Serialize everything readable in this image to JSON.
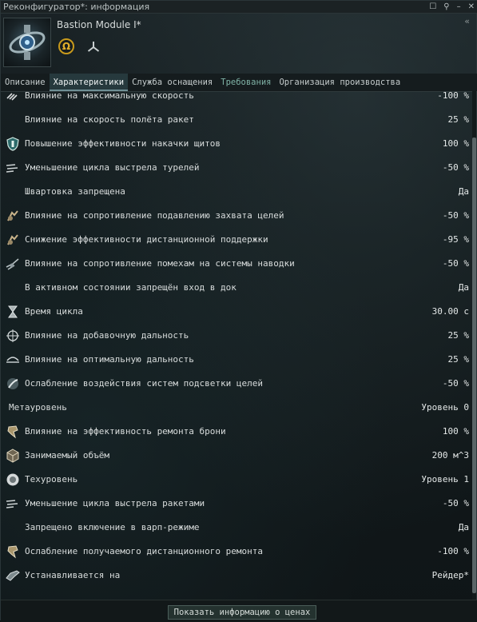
{
  "window": {
    "title": "Реконфигуратор*: информация"
  },
  "titlebar_icons": [
    "square-icon",
    "pin-icon",
    "minimize-icon",
    "close-icon"
  ],
  "item": {
    "name": "Bastion Module I*",
    "meta_badge": "Ω",
    "collapse": "«"
  },
  "tabs": [
    {
      "label": "Описание"
    },
    {
      "label": "Характеристики",
      "active": true
    },
    {
      "label": "Служба оснащения"
    },
    {
      "label": "Требования"
    },
    {
      "label": "Организация производства"
    }
  ],
  "attributes": [
    {
      "icon": "speed-icon",
      "label": "Влияние на максимальную скорость",
      "value": "-100 %"
    },
    {
      "icon": "",
      "label": "Влияние на скорость полёта ракет",
      "value": "25 %"
    },
    {
      "icon": "shield-boost-icon",
      "label": "Повышение эффективности накачки щитов",
      "value": "100 %"
    },
    {
      "icon": "turret-rof-icon",
      "label": "Уменьшение цикла выстрела турелей",
      "value": "-50 %"
    },
    {
      "icon": "",
      "label": "Швартовка запрещена",
      "value": "Да"
    },
    {
      "icon": "ewar-resist-icon",
      "label": "Влияние на сопротивление подавлению захвата целей",
      "value": "-50 %"
    },
    {
      "icon": "remote-support-icon",
      "label": "Снижение эффективности дистанционной поддержки",
      "value": "-95 %"
    },
    {
      "icon": "guidance-disruption-icon",
      "label": "Влияние на сопротивление помехам на системы наводки",
      "value": "-50 %"
    },
    {
      "icon": "",
      "label": "В активном состоянии запрещён вход в док",
      "value": "Да"
    },
    {
      "icon": "hourglass-icon",
      "label": "Время цикла",
      "value": "30.00 с"
    },
    {
      "icon": "crosshair-icon",
      "label": "Влияние на добавочную дальность",
      "value": "25 %"
    },
    {
      "icon": "optimal-range-icon",
      "label": "Влияние на оптимальную дальность",
      "value": "25 %"
    },
    {
      "icon": "target-painter-icon",
      "label": "Ослабление воздействия систем подсветки целей",
      "value": "-50 %"
    },
    {
      "icon": "",
      "label": "Метауровень",
      "value": "Уровень 0",
      "meta": true
    },
    {
      "icon": "armor-repair-icon",
      "label": "Влияние на эффективность ремонта брони",
      "value": "100 %"
    },
    {
      "icon": "cube-icon",
      "label": "Занимаемый объём",
      "value": "200 м^3"
    },
    {
      "icon": "tech-level-icon",
      "label": "Техуровень",
      "value": "Уровень 1"
    },
    {
      "icon": "missile-rof-icon",
      "label": "Уменьшение цикла выстрела ракетами",
      "value": "-50 %"
    },
    {
      "icon": "",
      "label": "Запрещено включение в варп-режиме",
      "value": "Да"
    },
    {
      "icon": "armor-repair-icon",
      "label": "Ослабление получаемого дистанционного ремонта",
      "value": "-100 %"
    },
    {
      "icon": "ship-icon",
      "label": "Устанавливается на",
      "value": "Рейдер*"
    }
  ],
  "footer": {
    "price_button": "Показать информацию о ценах"
  },
  "colors": {
    "background": "#121a1c",
    "active_tab": "#26393d",
    "omega_gold": "#e3b02a",
    "requirements_tab": "#7fb2a6"
  }
}
